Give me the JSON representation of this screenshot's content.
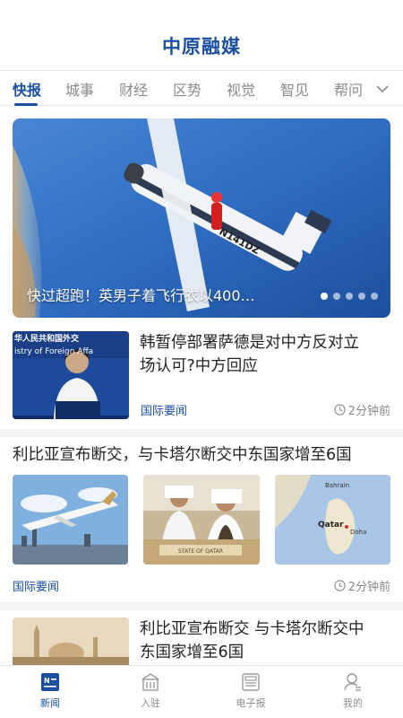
{
  "app": {
    "title": "中原融媒"
  },
  "tabs": [
    "快报",
    "城事",
    "财经",
    "区势",
    "视觉",
    "智见",
    "帮问"
  ],
  "banner": {
    "caption": "快过超跑！英男子着飞行衣以400…",
    "slide_count": 5,
    "active_slide": 1
  },
  "news": [
    {
      "title_line1": "韩暂停部署萨德是对中方反对立",
      "title_line2": "场认可?中方回应",
      "tag": "国际要闻",
      "time": "2分钟前",
      "thumb_text_line1": "华人民共和国外交",
      "thumb_text_line2": "istry of Foreign Affa"
    },
    {
      "title": "利比亚宣布断交，与卡塔尔断交中东国家增至6国",
      "tag": "国际要闻",
      "time": "2分钟前",
      "map_labels": [
        "Bahrain",
        "Qatar",
        "Doha"
      ],
      "desk_text": "STATE OF QATAR"
    },
    {
      "title_line1": "利比亚宣布断交 与卡塔尔断交中",
      "title_line2": "东国家增至6国"
    }
  ],
  "bottom_nav": [
    {
      "label": "新闻",
      "icon": "news-icon",
      "active": true
    },
    {
      "label": "入驻",
      "icon": "building-icon",
      "active": false
    },
    {
      "label": "电子报",
      "icon": "newspaper-icon",
      "active": false
    },
    {
      "label": "我的",
      "icon": "user-icon",
      "active": false
    }
  ],
  "colors": {
    "accent": "#1b4fa0",
    "muted": "#8a8a8a",
    "divider": "#f3f4f6"
  }
}
